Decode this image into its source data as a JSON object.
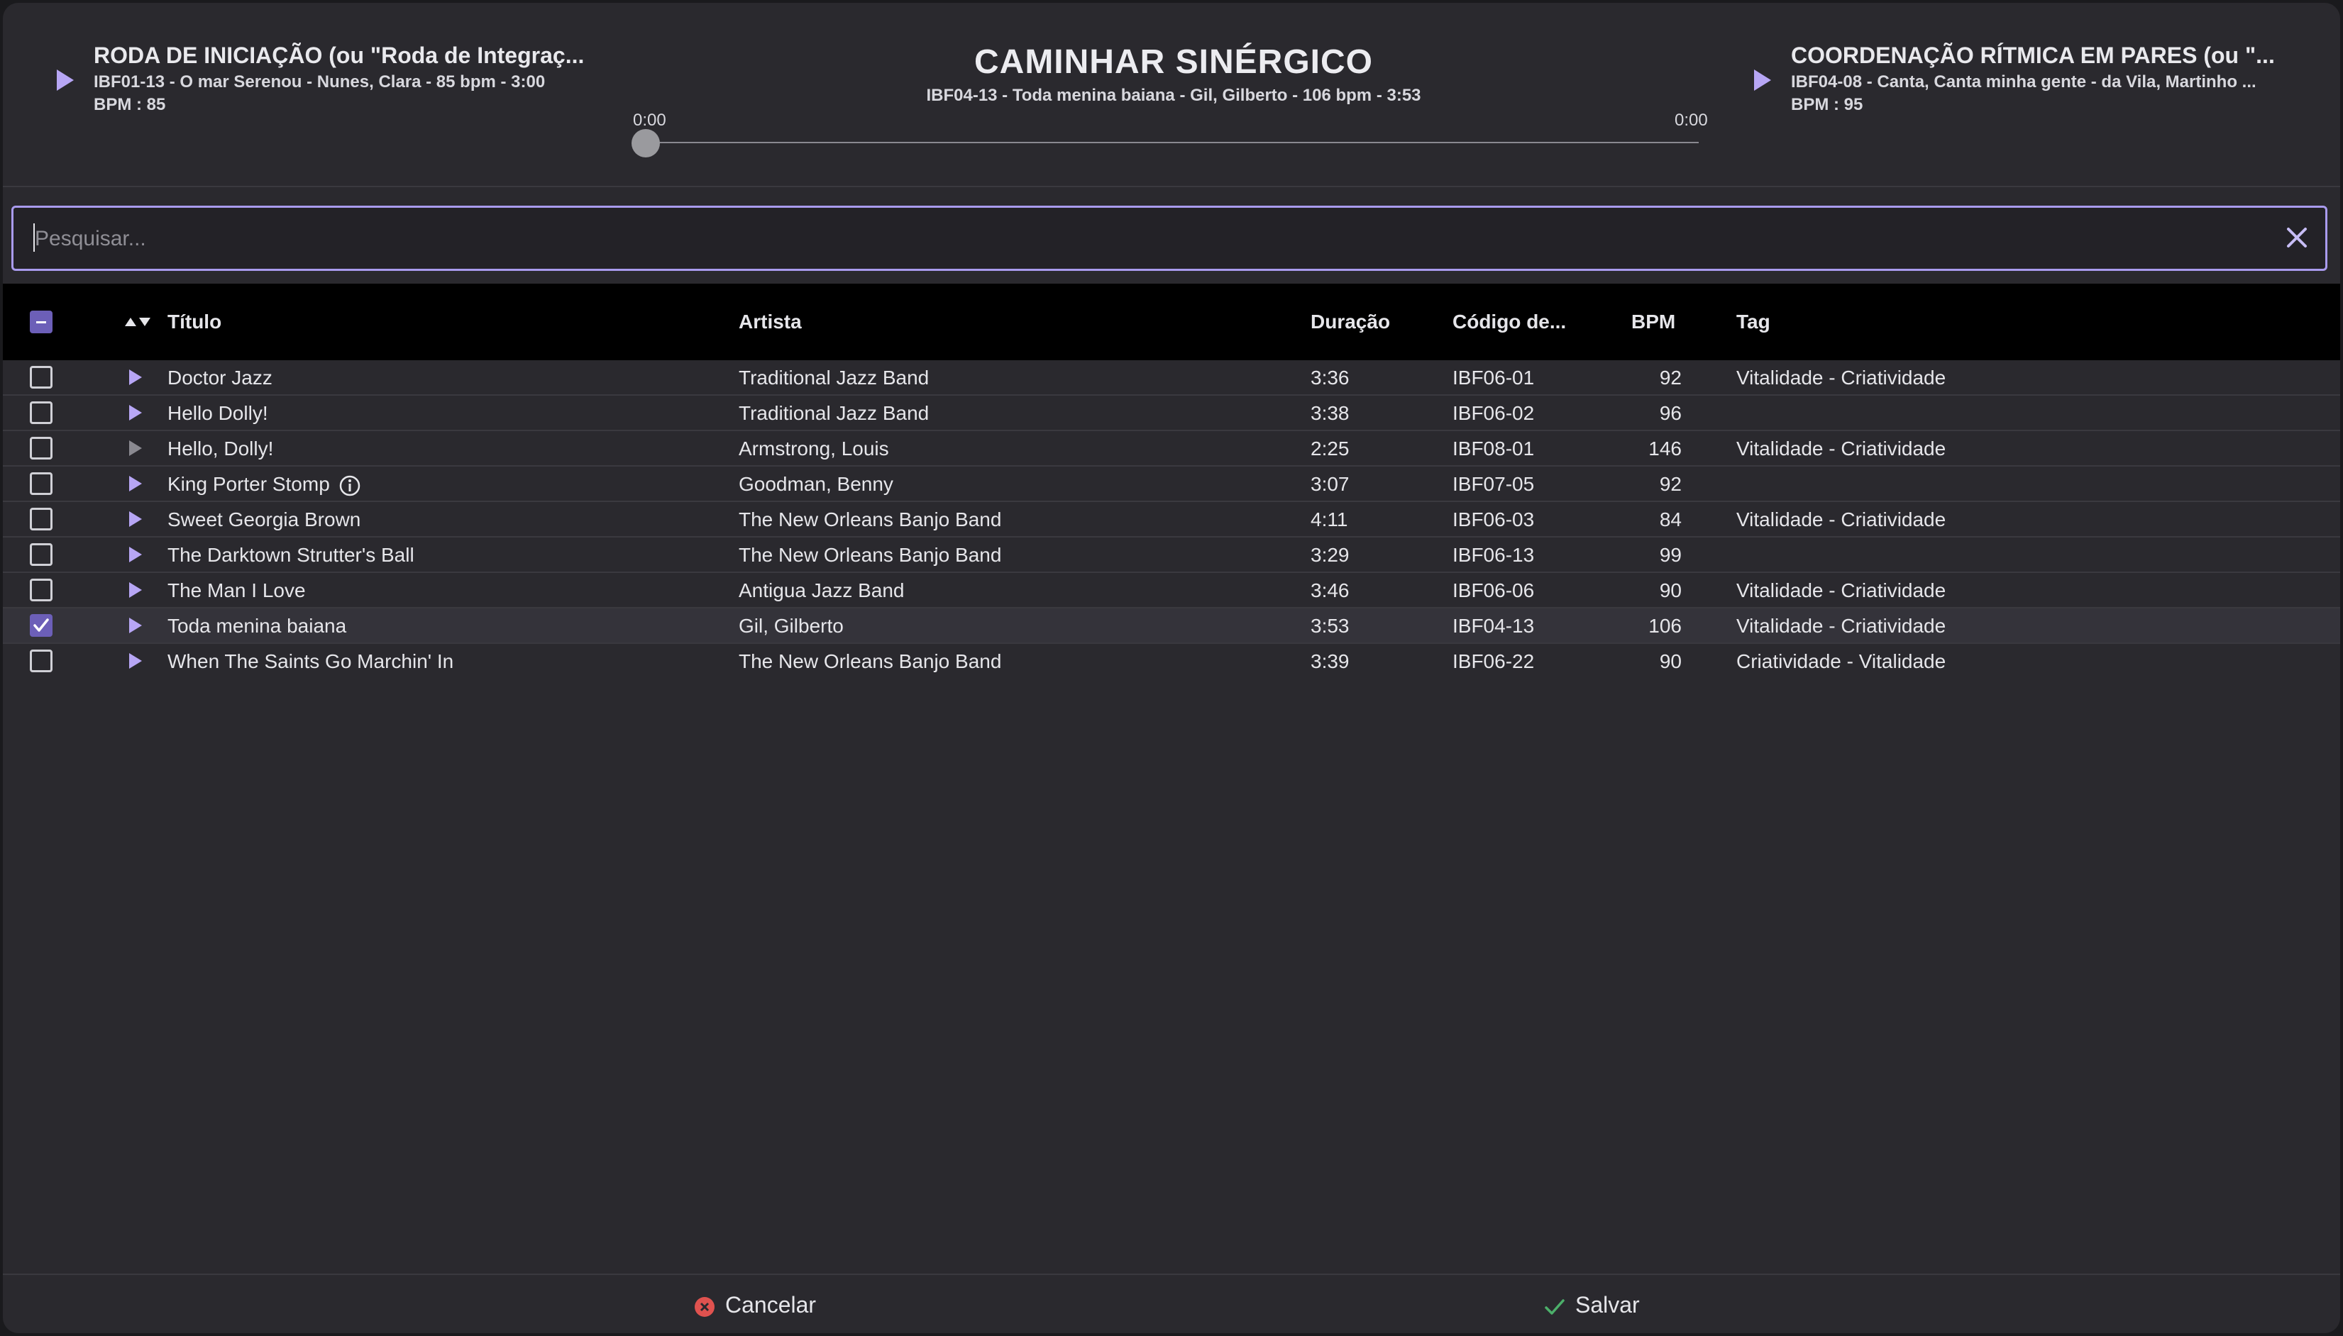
{
  "header": {
    "prev": {
      "title": "RODA DE INICIAÇÃO (ou \"Roda de Integraç...",
      "line": "IBF01-13 - O mar Serenou - Nunes, Clara - 85 bpm - 3:00",
      "bpm": "BPM : 85"
    },
    "current": {
      "title": "CAMINHAR SINÉRGICO",
      "line": "IBF04-13 - Toda menina baiana - Gil, Gilberto - 106 bpm - 3:53",
      "time_start": "0:00",
      "time_end": "0:00",
      "progress": 0
    },
    "next": {
      "title": "COORDENAÇÃO RÍTMICA EM PARES (ou \"...",
      "line": "IBF04-08 - Canta, Canta minha gente - da Vila, Martinho ...",
      "bpm": "BPM : 95"
    }
  },
  "search": {
    "placeholder": "Pesquisar...",
    "value": ""
  },
  "table": {
    "headers": {
      "title": "Título",
      "artist": "Artista",
      "duration": "Duração",
      "code": "Código de...",
      "bpm": "BPM",
      "tag": "Tag"
    },
    "rows": [
      {
        "title": "Doctor Jazz",
        "artist": "Traditional Jazz Band",
        "duration": "3:36",
        "code": "IBF06-01",
        "bpm": "92",
        "tag": "Vitalidade - Criatividade",
        "checked": false
      },
      {
        "title": "Hello Dolly!",
        "artist": "Traditional Jazz Band",
        "duration": "3:38",
        "code": "IBF06-02",
        "bpm": "96",
        "tag": "",
        "checked": false
      },
      {
        "title": "Hello, Dolly!",
        "artist": "Armstrong, Louis",
        "duration": "2:25",
        "code": "IBF08-01",
        "bpm": "146",
        "tag": "Vitalidade - Criatividade",
        "checked": false
      },
      {
        "title": "King Porter Stomp",
        "artist": "Goodman, Benny",
        "duration": "3:07",
        "code": "IBF07-05",
        "bpm": "92",
        "tag": "",
        "checked": false
      },
      {
        "title": "Sweet Georgia Brown",
        "artist": "The New Orleans Banjo Band",
        "duration": "4:11",
        "code": "IBF06-03",
        "bpm": "84",
        "tag": "Vitalidade - Criatividade",
        "checked": false
      },
      {
        "title": "The Darktown Strutter's Ball",
        "artist": "The New Orleans Banjo Band",
        "duration": "3:29",
        "code": "IBF06-13",
        "bpm": "99",
        "tag": "",
        "checked": false
      },
      {
        "title": "The Man I Love",
        "artist": "Antigua Jazz Band",
        "duration": "3:46",
        "code": "IBF06-06",
        "bpm": "90",
        "tag": "Vitalidade - Criatividade",
        "checked": false
      },
      {
        "title": "Toda menina baiana",
        "artist": "Gil, Gilberto",
        "duration": "3:53",
        "code": "IBF04-13",
        "bpm": "106",
        "tag": "Vitalidade - Criatividade",
        "checked": true
      },
      {
        "title": "When The Saints Go Marchin' In",
        "artist": "The New Orleans Banjo Band",
        "duration": "3:39",
        "code": "IBF06-22",
        "bpm": "90",
        "tag": "Criatividade - Vitalidade",
        "checked": false
      }
    ]
  },
  "footer": {
    "cancel_label": "Cancelar",
    "save_label": "Salvar"
  },
  "colors": {
    "accent": "#b7a6f5",
    "checkbox": "#6c5fb8",
    "cancel": "#e0524f",
    "save": "#4caf6a"
  },
  "icons": {
    "play": "play-icon",
    "info": "info-icon",
    "clear": "close-icon",
    "sort": "sort-icon",
    "cancel": "cancel-circle-icon",
    "save": "check-icon"
  }
}
